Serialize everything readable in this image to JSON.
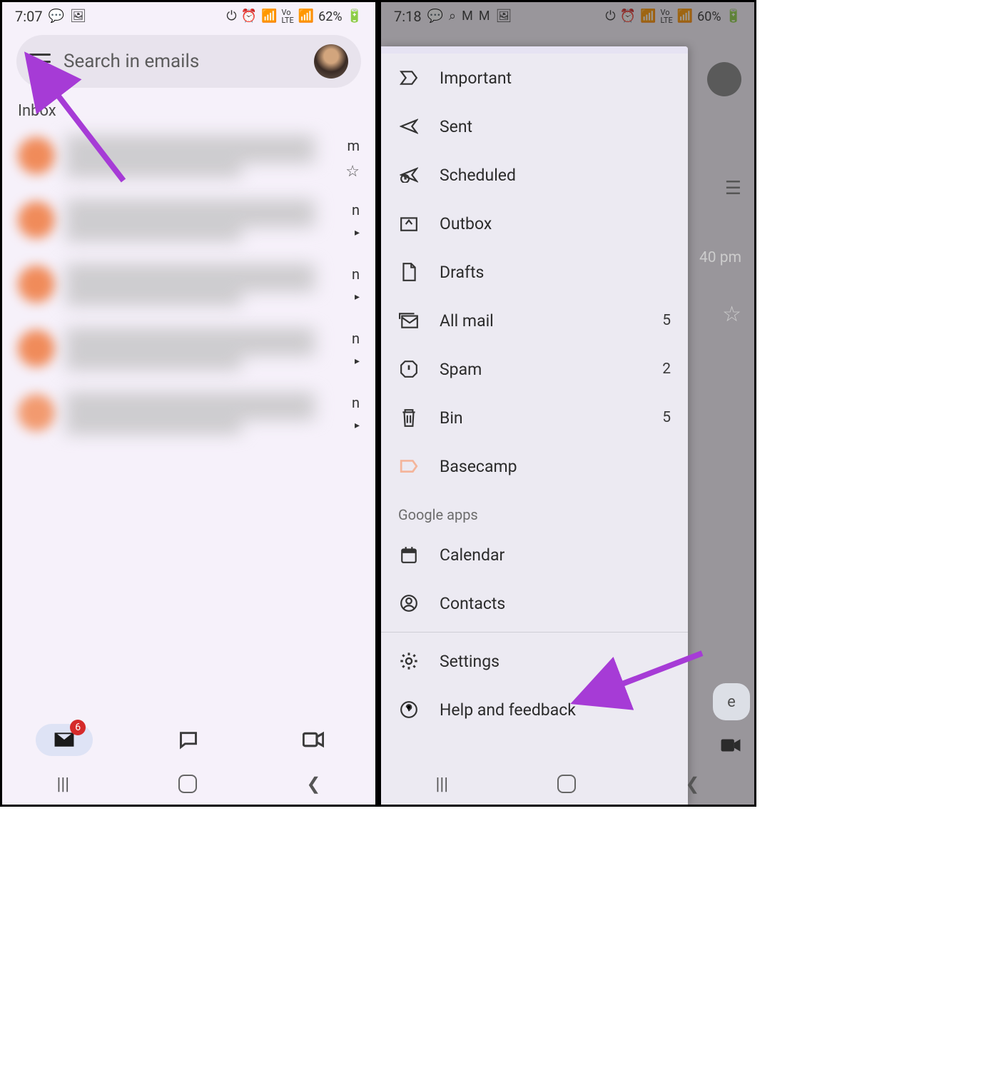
{
  "left": {
    "status": {
      "time": "7:07",
      "battery": "62%"
    },
    "search": {
      "placeholder": "Search in emails"
    },
    "section": "Inbox",
    "emails": [
      {
        "avatar_color": "#f08b5a",
        "time": "m",
        "flag": "star"
      },
      {
        "avatar_color": "#f08b5a",
        "time": "n",
        "flag": "caret"
      },
      {
        "avatar_color": "#f08b5a",
        "time": "n",
        "flag": "caret"
      },
      {
        "avatar_color": "#f08b5a",
        "time": "n",
        "flag": "caret"
      },
      {
        "avatar_color": "#f29a6f",
        "time": "n",
        "flag": "caret"
      }
    ],
    "bottomnav": {
      "mail_badge": "6"
    }
  },
  "right": {
    "status": {
      "time": "7:18",
      "battery": "60%"
    },
    "drawer": {
      "items": [
        {
          "icon": "important",
          "label": "Important"
        },
        {
          "icon": "sent",
          "label": "Sent"
        },
        {
          "icon": "scheduled",
          "label": "Scheduled"
        },
        {
          "icon": "outbox",
          "label": "Outbox"
        },
        {
          "icon": "drafts",
          "label": "Drafts"
        },
        {
          "icon": "allmail",
          "label": "All mail",
          "count": "5"
        },
        {
          "icon": "spam",
          "label": "Spam",
          "count": "2"
        },
        {
          "icon": "bin",
          "label": "Bin",
          "count": "5"
        },
        {
          "icon": "label-basecamp",
          "label": "Basecamp",
          "color": "#f4b59b"
        }
      ],
      "section_header": "Google apps",
      "apps": [
        {
          "icon": "calendar",
          "label": "Calendar"
        },
        {
          "icon": "contacts",
          "label": "Contacts"
        }
      ],
      "footer": [
        {
          "icon": "settings",
          "label": "Settings"
        },
        {
          "icon": "help",
          "label": "Help and feedback"
        }
      ]
    },
    "scrim": {
      "time": "40 pm",
      "fab_text": "e"
    }
  }
}
